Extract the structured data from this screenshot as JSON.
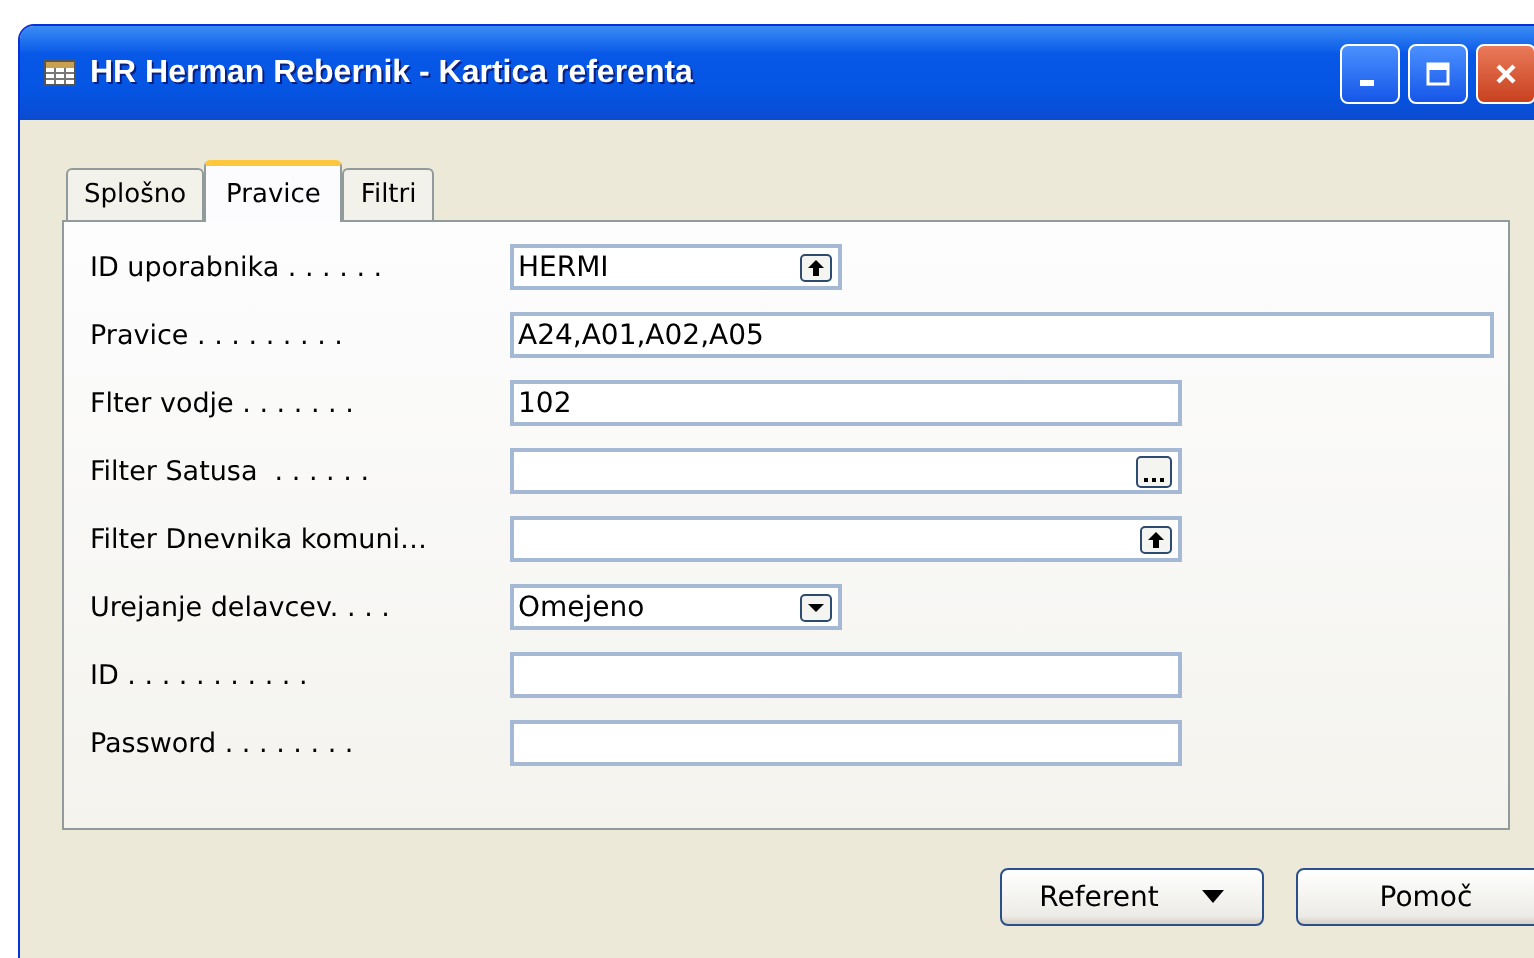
{
  "window": {
    "title": "HR Herman Rebernik - Kartica referenta"
  },
  "tabs": [
    {
      "label": "Splošno",
      "selected": false
    },
    {
      "label": "Pravice",
      "selected": true
    },
    {
      "label": "Filtri",
      "selected": false
    }
  ],
  "fields": [
    {
      "label": "ID uporabnika . . . . . .",
      "value": "HERMI",
      "kind": "lookup"
    },
    {
      "label": "Pravice . . . . . . . . .",
      "value": "A24,A01,A02,A05",
      "kind": "text"
    },
    {
      "label": "Flter vodje . . . . . . .",
      "value": "102",
      "kind": "text"
    },
    {
      "label": "Filter Satusa  . . . . . .",
      "kind": "assist"
    },
    {
      "label": "Filter Dnevnika komuni…",
      "kind": "lookup"
    },
    {
      "label": "Urejanje delavcev. . . .",
      "value": "Omejeno",
      "kind": "dropdown"
    },
    {
      "label": "ID . . . . . . . . . . .",
      "kind": "text"
    },
    {
      "label": "Password . . . . . . . .",
      "kind": "text"
    }
  ],
  "buttons": [
    {
      "label": "Referent",
      "kind": "menu"
    },
    {
      "label": "Pomoč",
      "kind": "plain"
    }
  ]
}
